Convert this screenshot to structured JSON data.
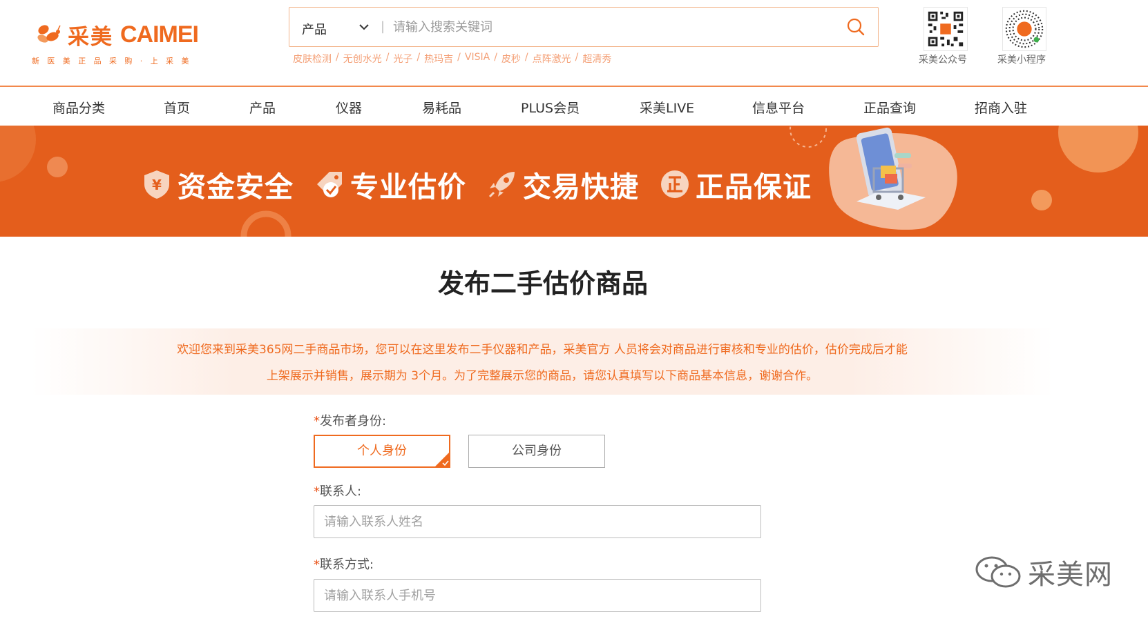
{
  "header": {
    "logo_cn": "采美",
    "logo_en": "CAIMEI",
    "logo_slogan": "新医美正品采购·上采美",
    "search": {
      "category": "产品",
      "placeholder": "请输入搜索关键词",
      "hot_links": [
        "皮肤检测",
        "无创水光",
        "光子",
        "热玛吉",
        "VISIA",
        "皮秒",
        "点阵激光",
        "超清秀"
      ],
      "separator": "/"
    },
    "qr_codes": [
      {
        "label": "采美公众号"
      },
      {
        "label": "采美小程序"
      }
    ]
  },
  "nav": {
    "items": [
      "商品分类",
      "首页",
      "产品",
      "仪器",
      "易耗品",
      "PLUS会员",
      "采美LIVE",
      "信息平台",
      "正品查询",
      "招商入驻"
    ]
  },
  "banner": {
    "features": [
      {
        "text": "资金安全",
        "icon": "shield-yen-icon"
      },
      {
        "text": "专业估价",
        "icon": "price-tag-check-icon"
      },
      {
        "text": "交易快捷",
        "icon": "rocket-icon"
      },
      {
        "text": "正品保证",
        "icon": "authentic-badge-icon"
      }
    ]
  },
  "page": {
    "title": "发布二手估价商品",
    "notice_line1": "欢迎您来到采美365网二手商品市场，您可以在这里发布二手仪器和产品，采美官方 人员将会对商品进行审核和专业的估价，估价完成后才能",
    "notice_line2": "上架展示并销售，展示期为 3个月。为了完整展示您的商品，请您认真填写以下商品基本信息，谢谢合作。"
  },
  "form": {
    "required_mark": "*",
    "identity_label": "发布者身份:",
    "identity_options": [
      "个人身份",
      "公司身份"
    ],
    "identity_selected": "个人身份",
    "contact_label": "联系人:",
    "contact_placeholder": "请输入联系人姓名",
    "phone_label": "联系方式:",
    "phone_placeholder": "请输入联系人手机号"
  },
  "watermark": {
    "text": "采美网"
  },
  "colors": {
    "brand_orange": "#ef6a1f",
    "banner_bg": "#e45e1c",
    "notice_bg": "#fdeee6"
  }
}
